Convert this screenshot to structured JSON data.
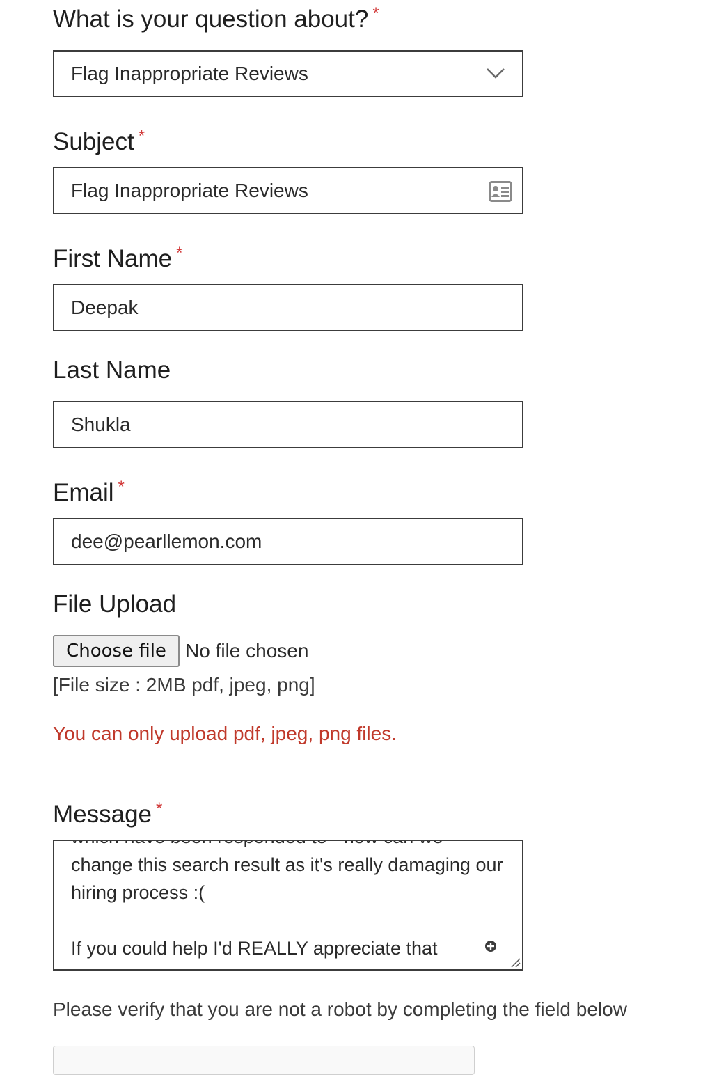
{
  "form": {
    "question": {
      "label": "What is your question about?",
      "required": "*",
      "value": "Flag Inappropriate Reviews",
      "icon": "chevron-down-icon"
    },
    "subject": {
      "label": "Subject",
      "required": "*",
      "value": "Flag Inappropriate Reviews",
      "icon": "contact-card-icon"
    },
    "first_name": {
      "label": "First Name",
      "required": "*",
      "value": "Deepak"
    },
    "last_name": {
      "label": "Last Name",
      "value": "Shukla"
    },
    "email": {
      "label": "Email",
      "required": "*",
      "value": "dee@pearllemon.com"
    },
    "file_upload": {
      "label": "File Upload",
      "button": "Choose file",
      "status": "No file chosen",
      "hint": "[File size : 2MB pdf, jpeg, png]",
      "error": "You can only upload pdf, jpeg, png files."
    },
    "message": {
      "label": "Message",
      "required": "*",
      "lines": [
        "which have been responded to - how can we",
        "change this search result as it's really damaging our",
        "hiring process :(",
        "",
        "If you could help I'd REALLY appreciate that"
      ]
    },
    "verify_text": "Please verify that you are not a robot by completing the field below"
  },
  "colors": {
    "required": "#d23c3c",
    "error": "#c0392b",
    "border": "#3c3c3c"
  }
}
